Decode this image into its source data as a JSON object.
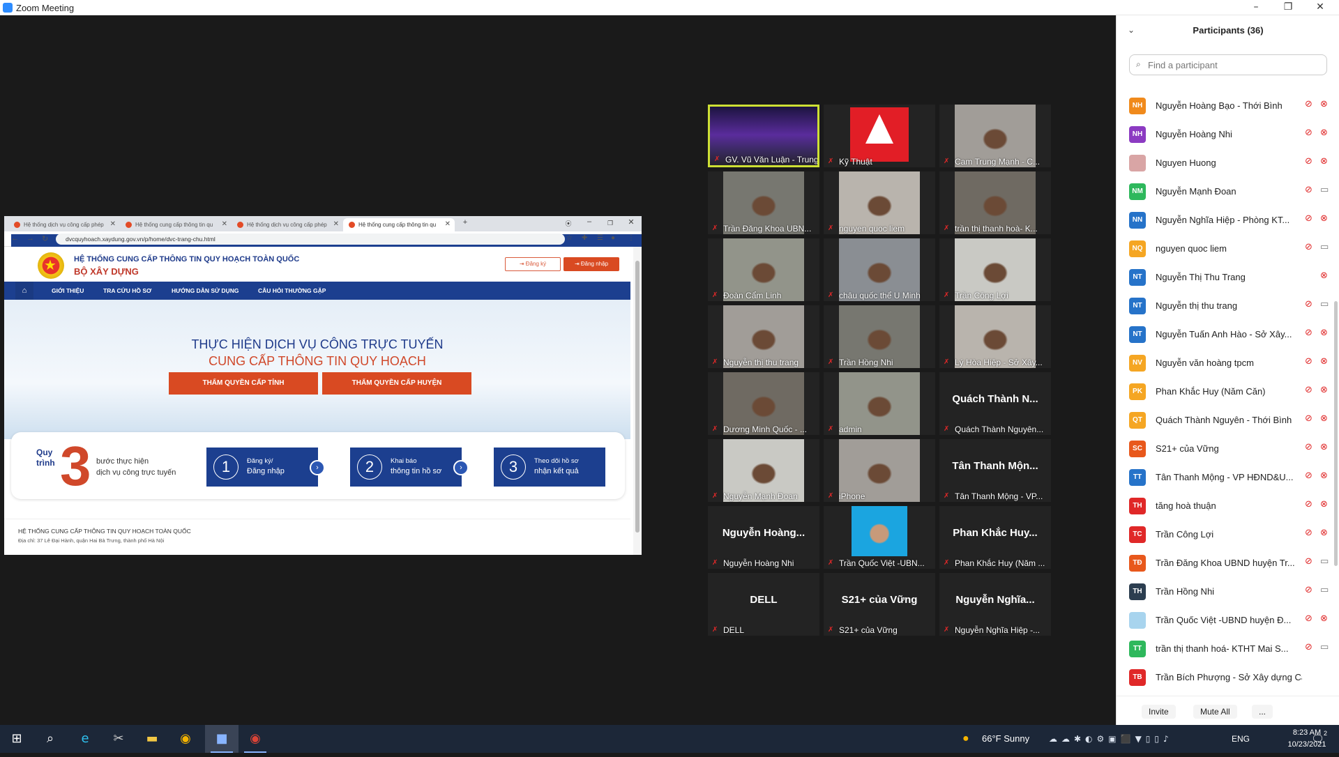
{
  "window": {
    "title": "Zoom Meeting",
    "minimize": "–",
    "restore": "❐",
    "close": "✕"
  },
  "browser": {
    "tabs": [
      {
        "label": "Hệ thống dịch vụ công cấp phép",
        "active": false
      },
      {
        "label": "Hệ thống cung cấp thông tin qu",
        "active": false
      },
      {
        "label": "Hệ thống dịch vụ công cấp phép",
        "active": false
      },
      {
        "label": "Hệ thống cung cấp thông tin qu",
        "active": true
      }
    ],
    "new_tab": "+",
    "url": "dvcquyhoach.xaydung.gov.vn/p/home/dvc-trang-chu.html"
  },
  "site": {
    "title_line1": "HỆ THỐNG CUNG CẤP THÔNG TIN QUY HOẠCH TOÀN QUỐC",
    "title_line2": "BỘ XÂY DỰNG",
    "register": "⇥ Đăng ký",
    "login": "⇥ Đăng nhập",
    "nav": [
      "GIỚI THIỆU",
      "TRA CỨU HỒ SƠ",
      "HƯỚNG DẪN SỬ DỤNG",
      "CÂU HỎI THƯỜNG GẶP"
    ],
    "hero_line1": "THỰC HIỆN DỊCH VỤ CÔNG TRỰC TUYẾN",
    "hero_line2": "CUNG CẤP THÔNG TIN QUY HOẠCH",
    "btn_province": "THẨM QUYỀN CẤP TỈNH",
    "btn_district": "THẨM QUYỀN CẤP HUYỆN",
    "process_label": "Quy trình",
    "process_number": "3",
    "process_desc1": "bước thực hiện",
    "process_desc2": "dịch vụ công trực tuyến",
    "steps": [
      {
        "num": "1",
        "line1": "Đăng ký/",
        "line2": "Đăng nhập"
      },
      {
        "num": "2",
        "line1": "Khai báo",
        "line2": "thông tin hồ sơ"
      },
      {
        "num": "3",
        "line1": "Theo dõi hồ sơ",
        "line2": "nhận kết quả"
      }
    ],
    "footer_title": "HỆ THỐNG CUNG CẤP THÔNG TIN QUY HOẠCH TOÀN QUỐC",
    "footer_addr": "Địa chỉ: 37 Lê Đại Hành, quận Hai Bà Trưng, thành phố Hà Nội"
  },
  "gallery": [
    {
      "name": "GV. Vũ Văn Luận - Trung...",
      "big": "",
      "video": "stage",
      "speaking": true
    },
    {
      "name": "Kỹ Thuật",
      "big": "",
      "video": "logo"
    },
    {
      "name": "Cam Trung Mạnh - C...",
      "big": "",
      "video": "cam"
    },
    {
      "name": "Trần Đăng Khoa UBN...",
      "big": "",
      "video": "cam"
    },
    {
      "name": "nguyen quoc liem",
      "big": "",
      "video": "cam"
    },
    {
      "name": "trần thị thanh hoà- K...",
      "big": "",
      "video": "cam"
    },
    {
      "name": "Đoàn Cẩm Linh",
      "big": "",
      "video": "cam"
    },
    {
      "name": "châu quốc thể U Minh",
      "big": "",
      "video": "cam"
    },
    {
      "name": "Trần Công Lợi",
      "big": "",
      "video": "cam"
    },
    {
      "name": "Nguyễn thị thu trang",
      "big": "",
      "video": "cam"
    },
    {
      "name": "Trần Hồng Nhi",
      "big": "",
      "video": "cam"
    },
    {
      "name": "Lý Hòa Hiệp - Sở Xây...",
      "big": "",
      "video": "cam"
    },
    {
      "name": "Dương Minh Quốc - ...",
      "big": "",
      "video": "cam"
    },
    {
      "name": "admin",
      "big": "",
      "video": "cam"
    },
    {
      "name": "Quách Thành Nguyên...",
      "big": "Quách Thành N...",
      "video": "none"
    },
    {
      "name": "Nguyễn Mạnh Đoan",
      "big": "",
      "video": "cam"
    },
    {
      "name": "iPhone",
      "big": "",
      "video": "cam"
    },
    {
      "name": "Tân Thanh Mộng - VP...",
      "big": "Tân Thanh Mộn...",
      "video": "none"
    },
    {
      "name": "Nguyễn Hoàng Nhi",
      "big": "Nguyễn Hoàng...",
      "video": "none"
    },
    {
      "name": "Trần Quốc Việt -UBN...",
      "big": "",
      "video": "portrait"
    },
    {
      "name": "Phan Khắc Huy (Năm ...",
      "big": "Phan Khắc Huy...",
      "video": "none"
    },
    {
      "name": "DELL",
      "big": "DELL",
      "video": "none"
    },
    {
      "name": "S21+ của Vững",
      "big": "S21+ của Vững",
      "video": "none"
    },
    {
      "name": "Nguyễn Nghĩa Hiệp -...",
      "big": "Nguyễn Nghĩa...",
      "video": "none"
    }
  ],
  "panel": {
    "title": "Participants (36)",
    "search_placeholder": "Find a participant",
    "invite": "Invite",
    "mute_all": "Mute All",
    "more": "...",
    "participants": [
      {
        "initials": "NH",
        "color": "#f08a1c",
        "name": "Nguyễn Hoàng Bạo - Thới Bình",
        "video_on": false
      },
      {
        "initials": "NH",
        "color": "#8c3bc2",
        "name": "Nguyễn Hoàng Nhi",
        "video_on": false
      },
      {
        "initials": "",
        "color": "#d9a5a5",
        "name": "Nguyen Huong",
        "video_on": false
      },
      {
        "initials": "NM",
        "color": "#2eb85c",
        "name": "Nguyễn Mạnh Đoan",
        "video_on": true
      },
      {
        "initials": "NN",
        "color": "#2673c9",
        "name": "Nguyễn Nghĩa Hiệp - Phòng KT...",
        "video_on": false
      },
      {
        "initials": "NQ",
        "color": "#f5a623",
        "name": "nguyen quoc liem",
        "video_on": true
      },
      {
        "initials": "NT",
        "color": "#2673c9",
        "name": "Nguyễn Thị Thu Trang",
        "video_on": false,
        "hide_mic": true
      },
      {
        "initials": "NT",
        "color": "#2673c9",
        "name": "Nguyễn thị thu trang",
        "video_on": true
      },
      {
        "initials": "NT",
        "color": "#2673c9",
        "name": "Nguyễn Tuấn Anh Hào - Sở Xây...",
        "video_on": false
      },
      {
        "initials": "NV",
        "color": "#f5a623",
        "name": "Nguyễn văn hoàng tpcm",
        "video_on": false
      },
      {
        "initials": "PK",
        "color": "#f5a623",
        "name": "Phan Khắc Huy (Năm Căn)",
        "video_on": false
      },
      {
        "initials": "QT",
        "color": "#f5a623",
        "name": "Quách Thành Nguyên - Thới Bình",
        "video_on": false
      },
      {
        "initials": "SC",
        "color": "#e8581c",
        "name": "S21+ của Vững",
        "video_on": false
      },
      {
        "initials": "TT",
        "color": "#2673c9",
        "name": "Tân Thanh Mộng - VP HĐND&U...",
        "video_on": false
      },
      {
        "initials": "TH",
        "color": "#e02828",
        "name": "tăng hoà thuận",
        "video_on": false
      },
      {
        "initials": "TC",
        "color": "#e02828",
        "name": "Trần Công Lợi",
        "video_on": false
      },
      {
        "initials": "TĐ",
        "color": "#e8581c",
        "name": "Trần Đăng Khoa UBND huyện Tr...",
        "video_on": true
      },
      {
        "initials": "TH",
        "color": "#2c3e50",
        "name": "Trần Hồng Nhi",
        "video_on": true
      },
      {
        "initials": "",
        "color": "#a8d4ee",
        "name": "Trần Quốc Việt -UBND huyện Đ...",
        "video_on": false
      },
      {
        "initials": "TT",
        "color": "#2eb85c",
        "name": "trần thị thanh hoá- KTHT Mai S...",
        "video_on": true
      },
      {
        "initials": "TB",
        "color": "#e02828",
        "name": "Trần Bích Phượng - Sở Xây dựng Cà Mau",
        "video_on": null
      }
    ]
  },
  "taskbar": {
    "weather": "66°F  Sunny",
    "lang": "ENG",
    "time": "8:23 AM",
    "date": "10/23/2021",
    "notif": "2"
  }
}
